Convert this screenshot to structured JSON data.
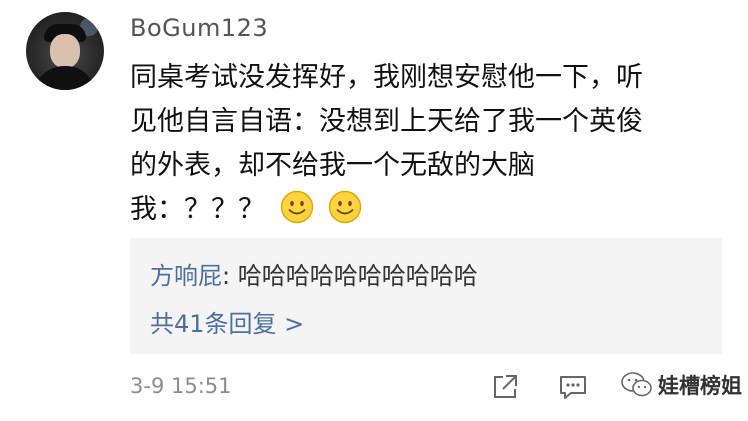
{
  "comment": {
    "username": "BoGum123",
    "lines": [
      "同桌考试没发挥好，我刚想安慰他一下，听",
      "见他自言自语：没想到上天给了我一个英俊",
      "的外表，却不给我一个无敌的大脑",
      "我：？？？"
    ],
    "emoji": [
      "smile-emoji",
      "smile-emoji"
    ],
    "timestamp": "3-9 15:51"
  },
  "replies": {
    "top_reply_user": "方响屁",
    "top_reply_separator": ": ",
    "top_reply_text": "哈哈哈哈哈哈哈哈哈哈",
    "more_label": "共41条回复 >"
  },
  "actions": {
    "share_icon": "share-icon",
    "comment_icon": "comment-icon"
  },
  "watermark": {
    "text": "娃槽榜姐",
    "icon": "wechat-icon"
  },
  "colors": {
    "link_blue": "#4b6f9f",
    "reply_bg": "#f4f4f4",
    "muted": "#8c8c8c",
    "emoji_yellow": "#ffd23f"
  }
}
